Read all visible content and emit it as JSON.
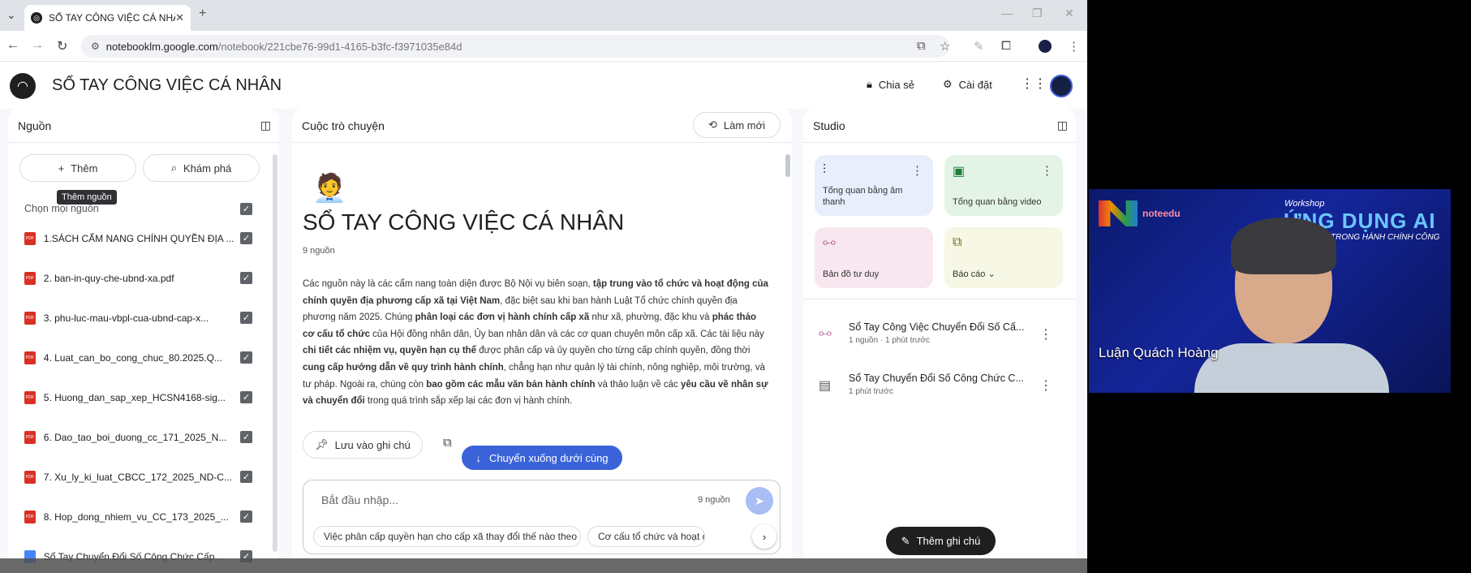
{
  "browser": {
    "tab_title": "SỔ TAY CÔNG VIỆC CÁ NHÂN",
    "url_host": "notebooklm.google.com",
    "url_path": "/notebook/221cbe76-99d1-4165-b3fc-f3971035e84d"
  },
  "header": {
    "title": "SỔ TAY CÔNG VIỆC CÁ NHÂN",
    "share_label": "Chia sẻ",
    "settings_label": "Cài đặt"
  },
  "sources": {
    "title": "Nguồn",
    "add_label": "Thêm",
    "discover_label": "Khám phá",
    "tooltip": "Thêm nguồn",
    "select_all": "Chọn mọi nguồn",
    "items": [
      {
        "label": "1.SÁCH CẨM NANG CHÍNH QUYỀN ĐỊA ...",
        "type": "pdf"
      },
      {
        "label": "2. ban-in-quy-che-ubnd-xa.pdf",
        "type": "pdf"
      },
      {
        "label": "3. phu-luc-mau-vbpl-cua-ubnd-cap-x...",
        "type": "pdf"
      },
      {
        "label": "4. Luat_can_bo_cong_chuc_80.2025.Q...",
        "type": "pdf"
      },
      {
        "label": "5. Huong_dan_sap_xep_HCSN4168-sig...",
        "type": "pdf"
      },
      {
        "label": "6. Dao_tao_boi_duong_cc_171_2025_N...",
        "type": "pdf"
      },
      {
        "label": "7. Xu_ly_ki_luat_CBCC_172_2025_ND-C...",
        "type": "pdf"
      },
      {
        "label": "8. Hop_dong_nhiem_vu_CC_173_2025_...",
        "type": "pdf"
      },
      {
        "label": "Sổ Tay Chuyển Đổi Số Công Chức Cấp ...",
        "type": "doc"
      }
    ]
  },
  "chat": {
    "title": "Cuộc trò chuyện",
    "refresh_label": "Làm mới",
    "notebook_title": "SỔ TAY CÔNG VIỆC CÁ NHÂN",
    "source_count": "9 nguồn",
    "summary_parts": [
      {
        "t": "Các nguồn này là các cẩm nang toàn diện được Bộ Nội vụ biên soạn, ",
        "b": false
      },
      {
        "t": "tập trung vào tổ chức và hoạt động của chính quyền địa phương cấp xã tại Việt Nam",
        "b": true
      },
      {
        "t": ", đặc biệt sau khi ban hành Luật Tổ chức chính quyền địa phương năm 2025. Chúng ",
        "b": false
      },
      {
        "t": "phân loại các đơn vị hành chính cấp xã",
        "b": true
      },
      {
        "t": " như xã, phường, đặc khu và ",
        "b": false
      },
      {
        "t": "phác thảo cơ cấu tổ chức",
        "b": true
      },
      {
        "t": " của Hội đồng nhân dân, Ủy ban nhân dân và các cơ quan chuyên môn cấp xã. Các tài liệu này ",
        "b": false
      },
      {
        "t": "chi tiết các nhiệm vụ, quyền hạn cụ thể",
        "b": true
      },
      {
        "t": " được phân cấp và ủy quyền cho từng cấp chính quyền, đồng thời ",
        "b": false
      },
      {
        "t": "cung cấp hướng dẫn về quy trình hành chính",
        "b": true
      },
      {
        "t": ", chẳng hạn như quản lý tài chính, nông nghiệp, môi trường, và tư pháp. Ngoài ra, chúng còn ",
        "b": false
      },
      {
        "t": "bao gồm các mẫu văn bản hành chính",
        "b": true
      },
      {
        "t": " và thảo luận về các ",
        "b": false
      },
      {
        "t": "yêu cầu về nhân sự và chuyển đổi",
        "b": true
      },
      {
        "t": " trong quá trình sắp xếp lại các đơn vị hành chính.",
        "b": false
      }
    ],
    "save_note_label": "Lưu vào ghi chú",
    "scroll_down_label": "Chuyển xuống dưới cùng",
    "input_placeholder": "Bắt đầu nhập...",
    "input_source_count": "9 nguồn",
    "suggestions": [
      "Việc phân cấp quyền hạn cho cấp xã thay đổi thế nào theo luật mới?",
      "Cơ cấu tổ chức và hoạt động"
    ]
  },
  "studio": {
    "title": "Studio",
    "cards": [
      {
        "label": "Tổng quan bằng âm thanh",
        "color": "#e8eefc"
      },
      {
        "label": "Tổng quan bằng video",
        "color": "#e3f4e6"
      },
      {
        "label": "Bản đồ tư duy",
        "color": "#f9e7f0"
      },
      {
        "label": "Báo cáo",
        "color": "#f6f7e4"
      }
    ],
    "notes": [
      {
        "title": "Sổ Tay Công Việc Chuyển Đổi Số Cấ...",
        "meta": "1 nguồn · 1 phút trước"
      },
      {
        "title": "Sổ Tay Chuyển Đổi Số Công Chức C...",
        "meta": "1 phút trước"
      }
    ],
    "add_note_label": "Thêm ghi chú"
  },
  "video": {
    "brand": "noteedu",
    "workshop": "Workshop",
    "headline": "ỨNG DỤNG AI",
    "subline": "TRONG HÀNH CHÍNH CÔNG",
    "participant": "Luận Quách Hoàng"
  }
}
